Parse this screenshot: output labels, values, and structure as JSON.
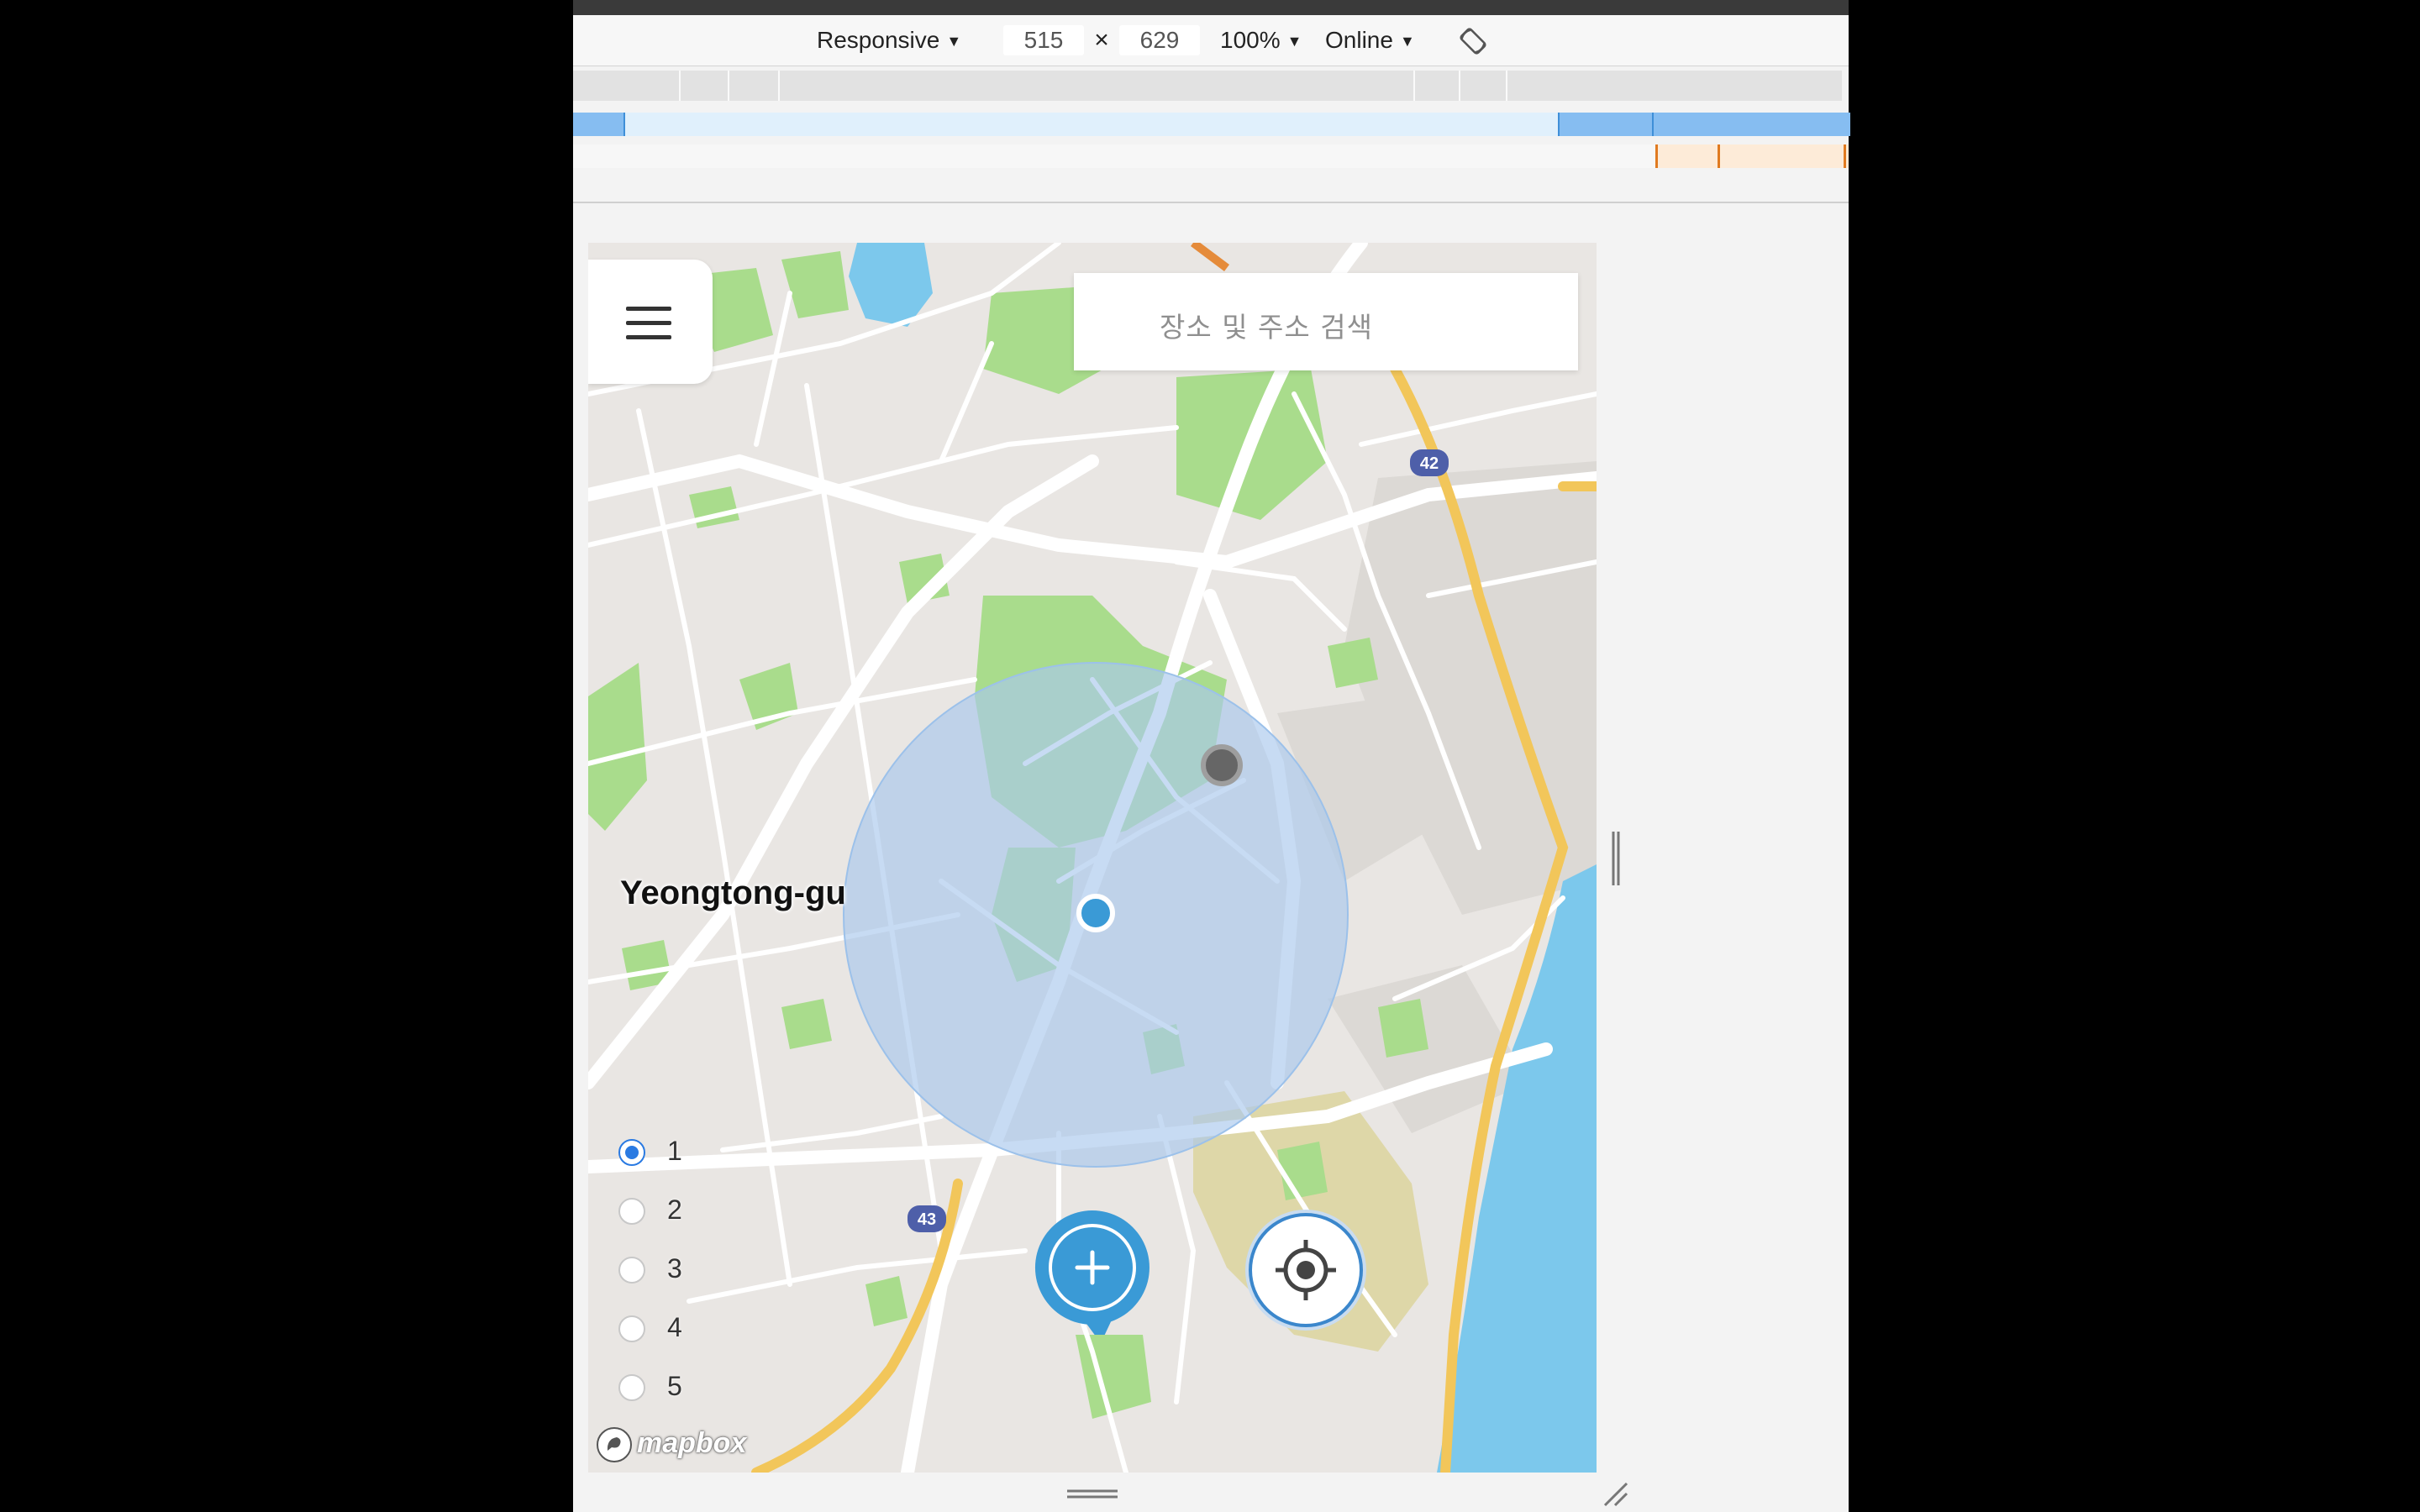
{
  "toolbar": {
    "device": "Responsive",
    "width": "515",
    "times": "×",
    "height": "629",
    "zoom": "100%",
    "network": "Online",
    "caret": "▼"
  },
  "map": {
    "search_placeholder": "장소 및 주소 검색",
    "district_label": "Yeongtong-gu",
    "route_shields": [
      "42",
      "43"
    ],
    "options": [
      {
        "label": "1",
        "checked": true
      },
      {
        "label": "2",
        "checked": false
      },
      {
        "label": "3",
        "checked": false
      },
      {
        "label": "4",
        "checked": false
      },
      {
        "label": "5",
        "checked": false
      }
    ],
    "attribution": "mapbox",
    "colors": {
      "accent": "#3a9ad6",
      "radius": "#a9c8ec",
      "park": "#a9dc8c",
      "water": "#7cc8ec",
      "highway": "#f2c65a"
    }
  }
}
